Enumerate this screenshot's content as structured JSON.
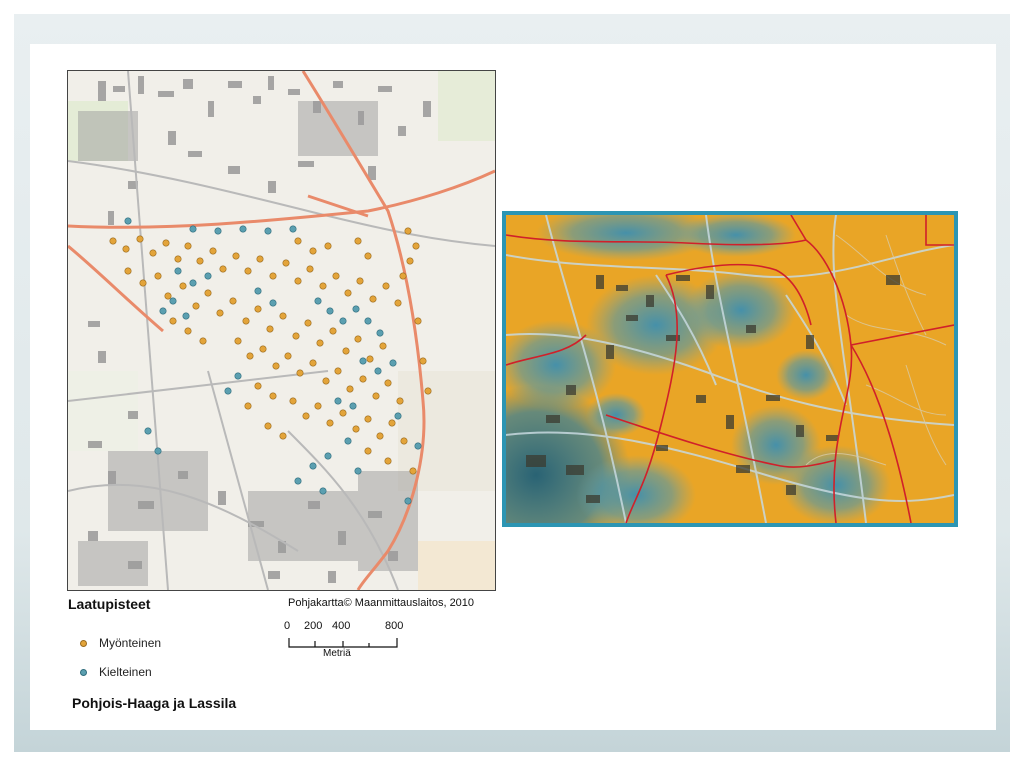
{
  "legend": {
    "title": "Laatupisteet",
    "items": [
      {
        "label": "Myönteinen",
        "color": "#e3a43a"
      },
      {
        "label": "Kielteinen",
        "color": "#5b9fb0"
      }
    ]
  },
  "credit": "Pohjakartta© Maanmittauslaitos,  2010",
  "scale": {
    "ticks": [
      "0",
      "200",
      "400",
      "800"
    ],
    "unit": "Metriä"
  },
  "area_name": "Pohjois-Haaga ja Lassila",
  "colors": {
    "positive": "#e3a43a",
    "negative": "#5b9fb0",
    "road": "#e98a6a",
    "boundary": "#d0202a",
    "frame": "#2c95b3"
  }
}
